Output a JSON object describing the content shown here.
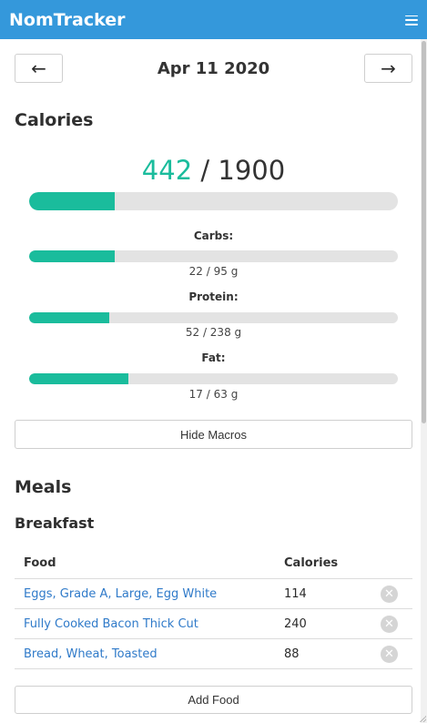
{
  "app": {
    "title": "NomTracker",
    "menu_icon": "hamburger-menu-icon"
  },
  "date_nav": {
    "prev_label": "←",
    "next_label": "→",
    "date": "Apr 11 2020"
  },
  "calories": {
    "heading": "Calories",
    "consumed": "442",
    "separator": " / ",
    "goal": "1900",
    "progress": 0.233
  },
  "macros": [
    {
      "label": "Carbs:",
      "value": "22 / 95 g",
      "progress": 0.232
    },
    {
      "label": "Protein:",
      "value": "52 / 238 g",
      "progress": 0.218
    },
    {
      "label": "Fat:",
      "value": "17 / 63 g",
      "progress": 0.27
    }
  ],
  "hide_macros_label": "Hide Macros",
  "meals": {
    "heading": "Meals",
    "breakfast": {
      "heading": "Breakfast",
      "columns": [
        "Food",
        "Calories"
      ],
      "rows": [
        {
          "food": "Eggs, Grade A, Large, Egg White",
          "calories": "114"
        },
        {
          "food": "Fully Cooked Bacon Thick Cut",
          "calories": "240"
        },
        {
          "food": "Bread, Wheat, Toasted",
          "calories": "88"
        }
      ],
      "remove_symbol": "✕",
      "add_label": "Add Food"
    }
  },
  "colors": {
    "navbar": "#3498db",
    "accent": "#1abc9c",
    "link": "#2f7ac9"
  }
}
